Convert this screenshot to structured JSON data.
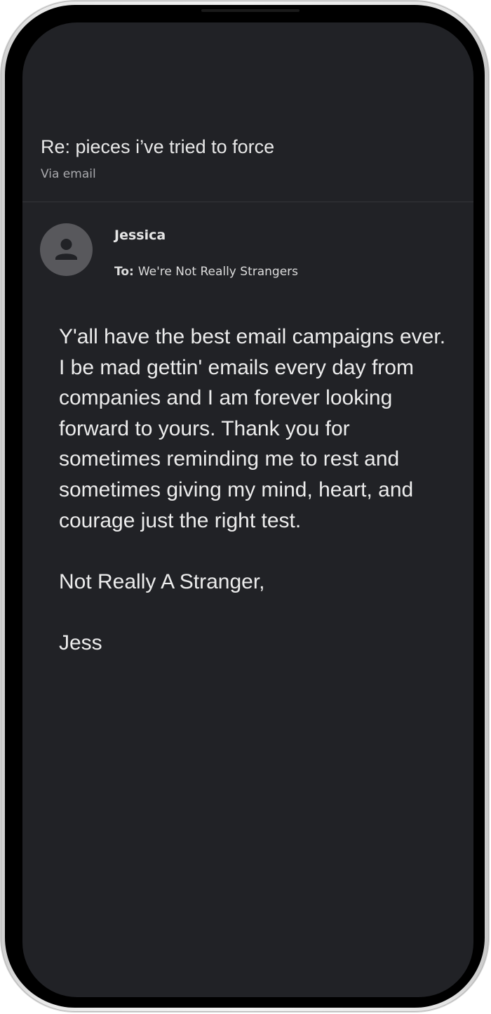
{
  "email": {
    "subject": "Re: pieces i’ve tried to force",
    "via": "Via email",
    "sender": {
      "name": "Jessica",
      "avatar_icon": "person-icon"
    },
    "to_label": "To:",
    "to_value": "We're Not Really Strangers",
    "body": {
      "paragraph1": "Y'all have the best email campaigns ever. I be mad gettin' emails every day from companies and I am forever looking forward to yours. Thank you for sometimes reminding me to rest and sometimes giving my mind, heart, and courage just the right test.",
      "paragraph2": "Not Really A Stranger,",
      "paragraph3": "Jess"
    }
  },
  "colors": {
    "screen_background": "#212226",
    "primary_text": "#ececec",
    "secondary_text": "#a9a9ad",
    "avatar_background": "#58585c"
  }
}
